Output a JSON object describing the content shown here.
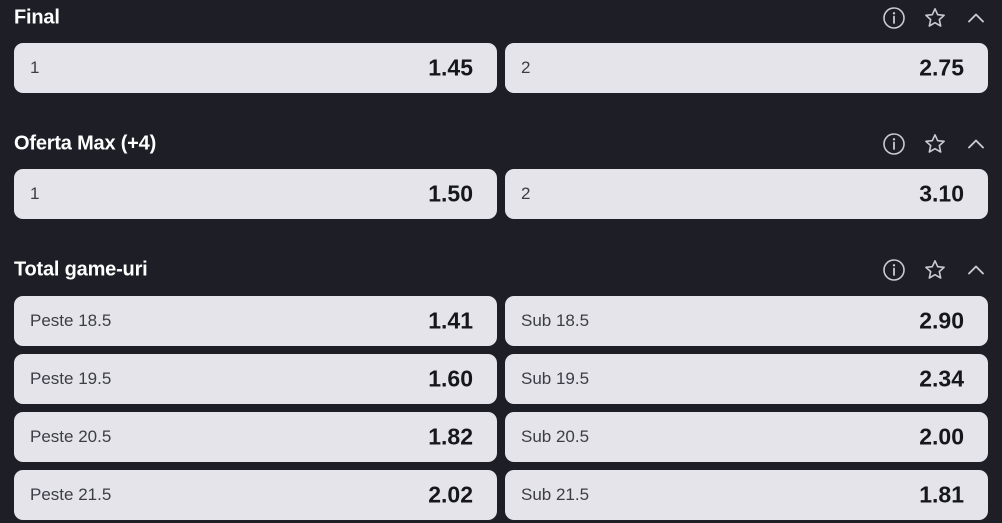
{
  "markets": [
    {
      "title": "Final",
      "odds": [
        {
          "label": "1",
          "value": "1.45"
        },
        {
          "label": "2",
          "value": "2.75"
        }
      ]
    },
    {
      "title": "Oferta Max (+4)",
      "odds": [
        {
          "label": "1",
          "value": "1.50"
        },
        {
          "label": "2",
          "value": "3.10"
        }
      ]
    },
    {
      "title": "Total game-uri",
      "odds": [
        {
          "label": "Peste 18.5",
          "value": "1.41"
        },
        {
          "label": "Sub 18.5",
          "value": "2.90"
        },
        {
          "label": "Peste 19.5",
          "value": "1.60"
        },
        {
          "label": "Sub 19.5",
          "value": "2.34"
        },
        {
          "label": "Peste 20.5",
          "value": "1.82"
        },
        {
          "label": "Sub 20.5",
          "value": "2.00"
        },
        {
          "label": "Peste 21.5",
          "value": "2.02"
        },
        {
          "label": "Sub 21.5",
          "value": "1.81"
        }
      ]
    }
  ],
  "icons": {
    "info": "info-icon",
    "favorite": "star-icon",
    "collapse": "chevron-up-icon"
  },
  "colors": {
    "background": "#1e1f26",
    "odd_button": "#e4e4ea",
    "title_text": "#ffffff",
    "icon": "#c9cad2"
  }
}
